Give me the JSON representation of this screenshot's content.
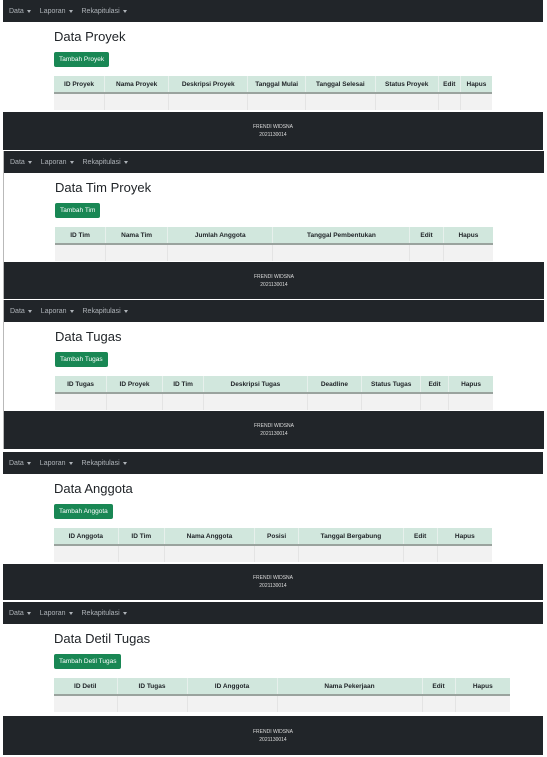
{
  "nav": {
    "data": "Data",
    "laporan": "Laporan",
    "rekapitulasi": "Rekapitulasi"
  },
  "footer": {
    "name": "FRENDI WIDSNA",
    "id": "2021130014"
  },
  "sections": [
    {
      "title": "Data Proyek",
      "button": "Tambah Proyek",
      "columns": [
        "ID Proyek",
        "Nama Proyek",
        "Deskripsi Proyek",
        "Tanggal Mulai",
        "Tanggal Selesai",
        "Status Proyek",
        "Edit",
        "Hapus"
      ]
    },
    {
      "title": "Data Tim Proyek",
      "button": "Tambah Tim",
      "columns": [
        "ID Tim",
        "Nama Tim",
        "Jumlah Anggota",
        "Tanggal Pembentukan",
        "Edit",
        "Hapus"
      ]
    },
    {
      "title": "Data Tugas",
      "button": "Tambah Tugas",
      "columns": [
        "ID Tugas",
        "ID Proyek",
        "ID Tim",
        "Deskripsi Tugas",
        "Deadline",
        "Status Tugas",
        "Edit",
        "Hapus"
      ]
    },
    {
      "title": "Data Anggota",
      "button": "Tambah Anggota",
      "columns": [
        "ID Anggota",
        "ID Tim",
        "Nama Anggota",
        "Posisi",
        "Tanggal Bergabung",
        "Edit",
        "Hapus"
      ]
    },
    {
      "title": "Data Detil Tugas",
      "button": "Tambah Detil Tugas",
      "columns": [
        "ID Detil",
        "ID Tugas",
        "ID Anggota",
        "Nama Pekerjaan",
        "Edit",
        "Hapus"
      ]
    }
  ]
}
